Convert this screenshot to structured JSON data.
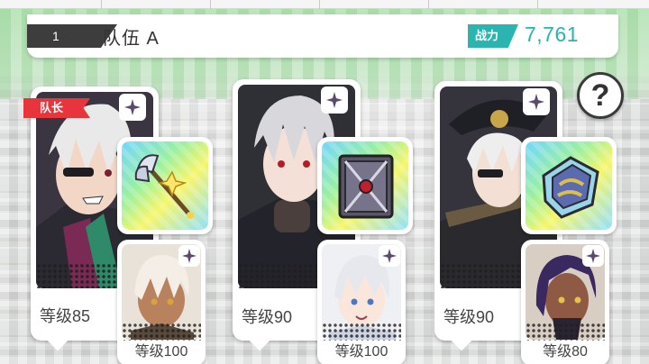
{
  "team": {
    "number": "1",
    "name": "队伍 A",
    "power_label": "战力",
    "power_value": "7,761"
  },
  "help": {
    "label": "?"
  },
  "leader_tag": "队长",
  "heroes": [
    {
      "level": "等级85",
      "weapon_icon": "halberd-icon",
      "support_level": "等级100",
      "colors": {
        "hair": "#e9e9ea",
        "coat": "#2b2a33",
        "accent": "#7a2a55"
      }
    },
    {
      "level": "等级90",
      "weapon_icon": "tome-icon",
      "support_level": "等级100",
      "colors": {
        "hair": "#d8d8dc",
        "coat": "#23232b",
        "accent": "#3a3a48"
      }
    },
    {
      "level": "等级90",
      "weapon_icon": "gauntlet-icon",
      "support_level": "等级80",
      "colors": {
        "hair": "#eeeeee",
        "coat": "#2a2a2e",
        "accent": "#c9a64a"
      }
    }
  ]
}
